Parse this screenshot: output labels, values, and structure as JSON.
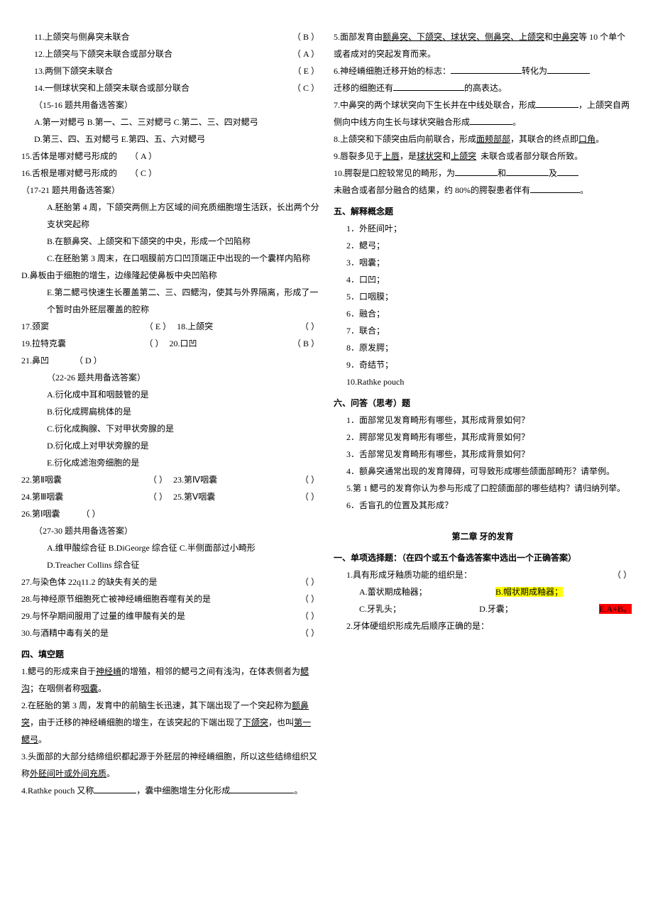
{
  "left": {
    "q11": {
      "text": "11.上颌突与侧鼻突未联合",
      "ans": "（  B  ）"
    },
    "q12": {
      "text": "12.上颌突与下颌突未联合或部分联合",
      "ans": "（  A  ）"
    },
    "q13": {
      "text": "13.两侧下颌突未联合",
      "ans": "（  E  ）"
    },
    "q14": {
      "text": "14.一侧球状突和上颌突未联合或部分联合",
      "ans": "（  C  ）"
    },
    "shared1516": "（15-16 题共用备选答案）",
    "optA1516": "A.第一对鳃弓 B.第一、二、三对鳃弓 C.第二、三、四对鳃弓",
    "optD1516": "D.第三、四、五对鳃弓 E.第四、五、六对鳃弓",
    "q15": {
      "text": "15.舌体是哪对鳃弓形成的",
      "ans": "（  A  ）"
    },
    "q16": {
      "text": "16.舌根是哪对鳃弓形成的",
      "ans": "（  C  ）"
    },
    "shared1721": "（17-21 题共用备选答案）",
    "optA1721": "A.胚胎第 4 周，下颌突两侧上方区域的间充质细胞增生活跃，长出两个分支状突起称",
    "optB1721": "B.在额鼻突、上颌突和下颌突的中央，形成一个凹陷称",
    "optC1721": "C.在胚胎第 3 周末，在口咽膜前方口凹顶端正中出现的一个囊样内陷称",
    "optD1721": "D.鼻板由于细胞的增生，边缘隆起使鼻板中央凹陷称",
    "optE1721": "E.第二鳃弓快速生长覆盖第二、三、四鳃沟，使其与外界隔离，形成了一个暂时由外胚层覆盖的腔称",
    "q17_18": {
      "l": "17.颈窦",
      "la": "（  E  ）",
      "r": "18.上颌突",
      "ra": "（     ）"
    },
    "q19_20": {
      "l": "19.拉特克囊",
      "la": "（     ）",
      "r": "20.口凹",
      "ra": "（  B  ）"
    },
    "q21": {
      "text": "21.鼻凹",
      "ans": "（  D   ）"
    },
    "shared2226": "（22-26 题共用备选答案）",
    "optA2226": "A.衍化成中耳和咽鼓管的是",
    "optB2226": "B.衍化成腭扁桃体的是",
    "optC2226": "C.衍化成胸腺、下对甲状旁腺的是",
    "optD2226": "D.衍化成上对甲状旁腺的是",
    "optE2226": "E.衍化成滤泡旁细胞的是",
    "q22_23": {
      "l": "22.第Ⅱ咽囊",
      "la": "（     ）",
      "r": "23.第Ⅳ咽囊",
      "ra": "（     ）"
    },
    "q24_25": {
      "l": "24.第Ⅲ咽囊",
      "la": "（     ）",
      "r": "25.第Ⅴ咽囊",
      "ra": "（     ）"
    },
    "q26": {
      "text": "26.第Ⅰ咽囊",
      "ans": "（     ）"
    },
    "shared2730": "（27-30 题共用备选答案）",
    "optA2730": "A.维甲酸综合征 B.DiGeorge 综合征 C.半侧面部过小畸形",
    "optD2730": "D.Treacher Collins 综合征",
    "q27": {
      "text": "27.与染色体 22q11.2 的缺失有关的是",
      "ans": "（     ）"
    },
    "q28": {
      "text": "28.与神经原节细胞死亡被神经嵴细胞吞噬有关的是",
      "ans": "（     ）"
    },
    "q29": {
      "text": "29.与怀孕期间服用了过量的维甲酸有关的是",
      "ans": "（     ）"
    },
    "q30": {
      "text": "30.与酒精中毒有关的是",
      "ans": "（     ）"
    },
    "sec4": "四、填空题",
    "f1a": "1.鳃弓的形成来自于",
    "f1b": "神经嵴",
    "f1c": "的增殖，相邻的鳃弓之间有浅沟，在体表侧者为",
    "f1d": "鳃沟",
    "f1e": "；在咽侧者称",
    "f1f": "咽囊",
    "f1g": "。",
    "f2a": "2.在胚胎的第 3 周，发育中的前脑生长迅速，其下端出现了一个突起称为",
    "f2b": "额鼻突",
    "f2c": "，由于迁移的神经嵴细胞的增生，在该突起的下端出现了",
    "f2d": "下颌突",
    "f2e": "，也叫",
    "f2f": "第一鳃弓",
    "f2g": "。",
    "f3a": "3.头面部的大部分结缔组织都起源于外胚层的神经嵴细胞，所以这些结缔组织又称",
    "f3b": "外胚间叶或外间充质",
    "f3c": "。",
    "f4a": "4.Rathke pouch 又称",
    "f4b": "，囊中细胞增生分化形成",
    "f4c": "。"
  },
  "right": {
    "f5a": "5.面部发育由",
    "f5b": "额鼻突、下颌突、球状突、侧鼻突、上颌突",
    "f5c": "和",
    "f5d": "中鼻突",
    "f5e": "等 10 个单个或者成对的突起发育而来。",
    "f6a": "6.神经嵴细胞迁移开始的标志：",
    "f6b": "转化为",
    "f6c": "迁移的细胞还有",
    "f6d": "的高表达。",
    "f7a": "7.中鼻突的两个球状突向下生长并在中线处联合，形成",
    "f7b": "，上颌突自两侧向中线方向生长与球状突融合形成",
    "f7c": "。",
    "f8a": "8.上颌突和下颌突由后向前联合，形成",
    "f8b": "面颊部部",
    "f8c": "，其联合的终点即",
    "f8d": "口角",
    "f8e": "。",
    "f9a": "9.唇裂多见于",
    "f9b": "上唇",
    "f9c": "，是",
    "f9d": "球状突",
    "f9e": "和",
    "f9f": "上颌突",
    "f9g": "未联合或者部分联合所致。",
    "f10a": "10.腭裂是口腔较常见的畸形，为",
    "f10b": "和",
    "f10c": "及",
    "f10d": "未融合或者部分融合的结果，约 80%的腭裂患者伴有",
    "f10e": "。",
    "sec5": "五、解释概念题",
    "c1": "1．外胚间叶；",
    "c2": "2．鳃弓；",
    "c3": "3．咽囊；",
    "c4": "4．口凹；",
    "c5": "5．口咽膜；",
    "c6": "6．融合；",
    "c7": "7．联合；",
    "c8": "8．原发腭；",
    "c9": "9．奇结节；",
    "c10": "10.Rathke pouch",
    "sec6": "六、问答（思考）题",
    "a1": "1．面部常见发育畸形有哪些，其形成背景如何？",
    "a2": "2．腭部常见发育畸形有哪些，其形成背景如何？",
    "a3": "3．舌部常见发育畸形有哪些，其形成背景如何？",
    "a4": "4．额鼻突通常出现的发育障碍，可导致形成哪些颌面部畸形？请举例。",
    "a5": "5.第 1 鳃弓的发育你认为参与形成了口腔颌面部的哪些结构？请归纳列举。",
    "a6": "6．舌盲孔的位置及其形成？",
    "ch2": "第二章  牙的发育",
    "sec1b": "一、单项选择题：（在四个或五个备选答案中选出一个正确答案）",
    "mq1": {
      "text": "1.具有形成牙釉质功能的组织是：",
      "ans": "（     ）"
    },
    "mq1a": "A.蕾状期成釉器；",
    "mq1b": "B.帽状期成釉器；",
    "mq1c": "C.牙乳头；",
    "mq1d": "D.牙囊；",
    "mq1e": "E.A+B。",
    "mq2": "2.牙体硬组织形成先后顺序正确的是："
  }
}
